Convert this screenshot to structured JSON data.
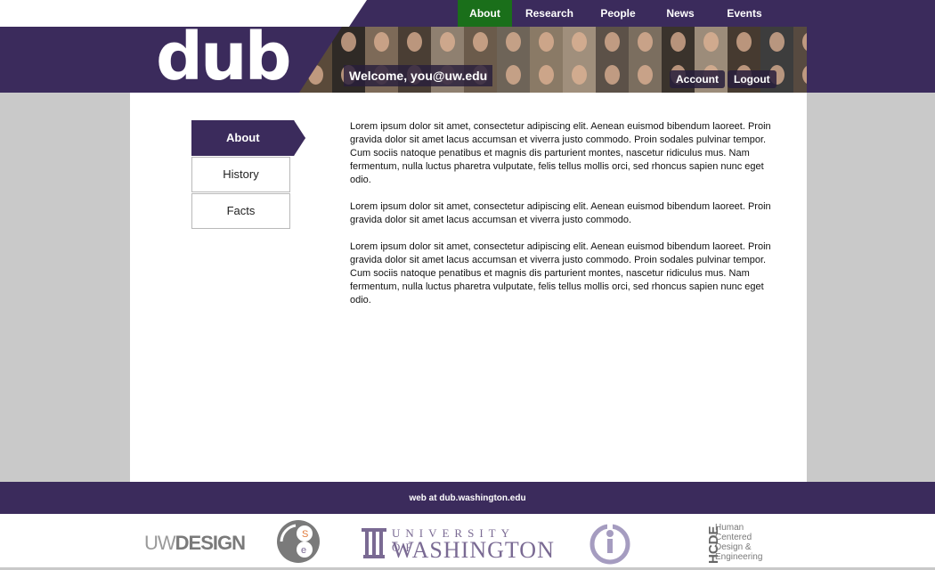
{
  "topnav": {
    "items": [
      "About",
      "Research",
      "People",
      "News",
      "Events"
    ],
    "active": "About"
  },
  "header": {
    "logo_text": "dub",
    "welcome": "Welcome, you@uw.edu",
    "account_label": "Account",
    "logout_label": "Logout"
  },
  "sidebar": {
    "items": [
      "About",
      "History",
      "Facts"
    ],
    "active": "About"
  },
  "main": {
    "paragraphs": [
      "Lorem ipsum dolor sit amet, consectetur adipiscing elit. Aenean euismod bibendum laoreet. Proin gravida dolor sit amet lacus accumsan et viverra justo commodo. Proin sodales pulvinar tempor. Cum sociis natoque penatibus et magnis dis parturient montes, nascetur ridiculus mus. Nam fermentum, nulla luctus pharetra vulputate, felis tellus mollis orci, sed rhoncus sapien nunc eget odio.",
      "Lorem ipsum dolor sit amet, consectetur adipiscing elit. Aenean euismod bibendum laoreet. Proin gravida dolor sit amet lacus accumsan et viverra justo commodo.",
      "Lorem ipsum dolor sit amet, consectetur adipiscing elit. Aenean euismod bibendum laoreet. Proin gravida dolor sit amet lacus accumsan et viverra justo commodo. Proin sodales pulvinar tempor. Cum sociis natoque penatibus et magnis dis parturient montes, nascetur ridiculus mus. Nam fermentum, nulla luctus pharetra vulputate, felis tellus mollis orci, sed rhoncus sapien nunc eget odio."
    ]
  },
  "footer": {
    "text": "web at dub.washington.edu",
    "logos": {
      "uwdesign_uw": "UW",
      "uwdesign_design": "DESIGN",
      "uw_university_of": "UNIVERSITY OF",
      "uw_washington": "WASHINGTON",
      "hcde_abbr": "HCDE",
      "hcde_lines": [
        "Human",
        "Centered",
        "Design &",
        "Engineering"
      ]
    }
  },
  "colors": {
    "brand_purple": "#3b2b5c",
    "active_green": "#1a6f1a",
    "page_gray": "#c9c9c9"
  }
}
